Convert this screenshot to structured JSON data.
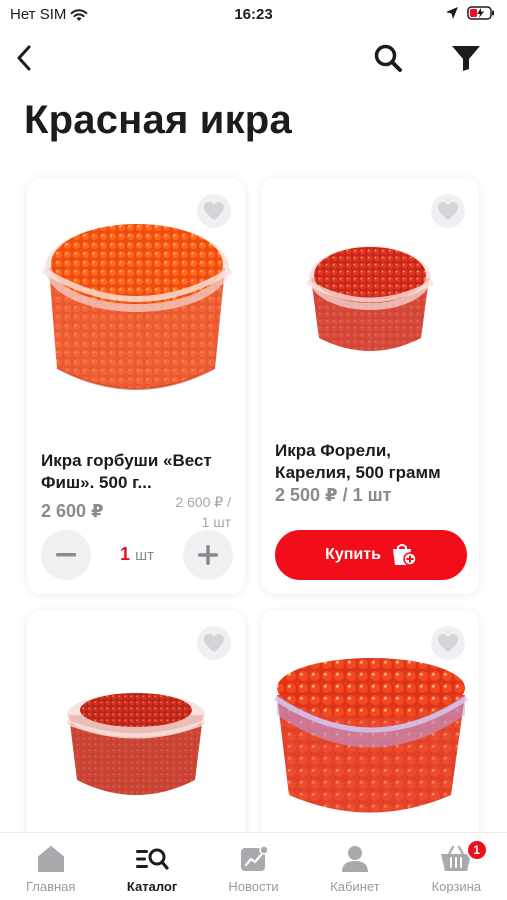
{
  "status_bar": {
    "carrier": "Нет SIM",
    "time": "16:23"
  },
  "nav": {
    "back_icon": "back-chevron-icon",
    "search_icon": "search-icon",
    "filter_icon": "filter-icon"
  },
  "page": {
    "title": "Красная икра"
  },
  "products": [
    {
      "name": "Икра горбуши «Вест Фиш». 500 г...",
      "price": "2 600 ₽",
      "unit_price_1": "2 600 ₽ /",
      "unit_price_2": "1 шт",
      "quantity": "1",
      "quantity_unit": "шт"
    },
    {
      "name": "Икра Форели, Карелия, 500 грамм",
      "price": "2 500 ₽ / 1 шт",
      "buy_label": "Купить"
    },
    {
      "name": ""
    },
    {
      "name": ""
    }
  ],
  "tabs": [
    {
      "label": "Главная",
      "icon": "home-icon"
    },
    {
      "label": "Каталог",
      "icon": "catalog-search-icon",
      "active": true
    },
    {
      "label": "Новости",
      "icon": "news-icon"
    },
    {
      "label": "Кабинет",
      "icon": "user-icon"
    },
    {
      "label": "Корзина",
      "icon": "basket-icon",
      "badge": "1"
    }
  ],
  "colors": {
    "accent": "#f20d1b",
    "caviar": "#e8321e"
  }
}
